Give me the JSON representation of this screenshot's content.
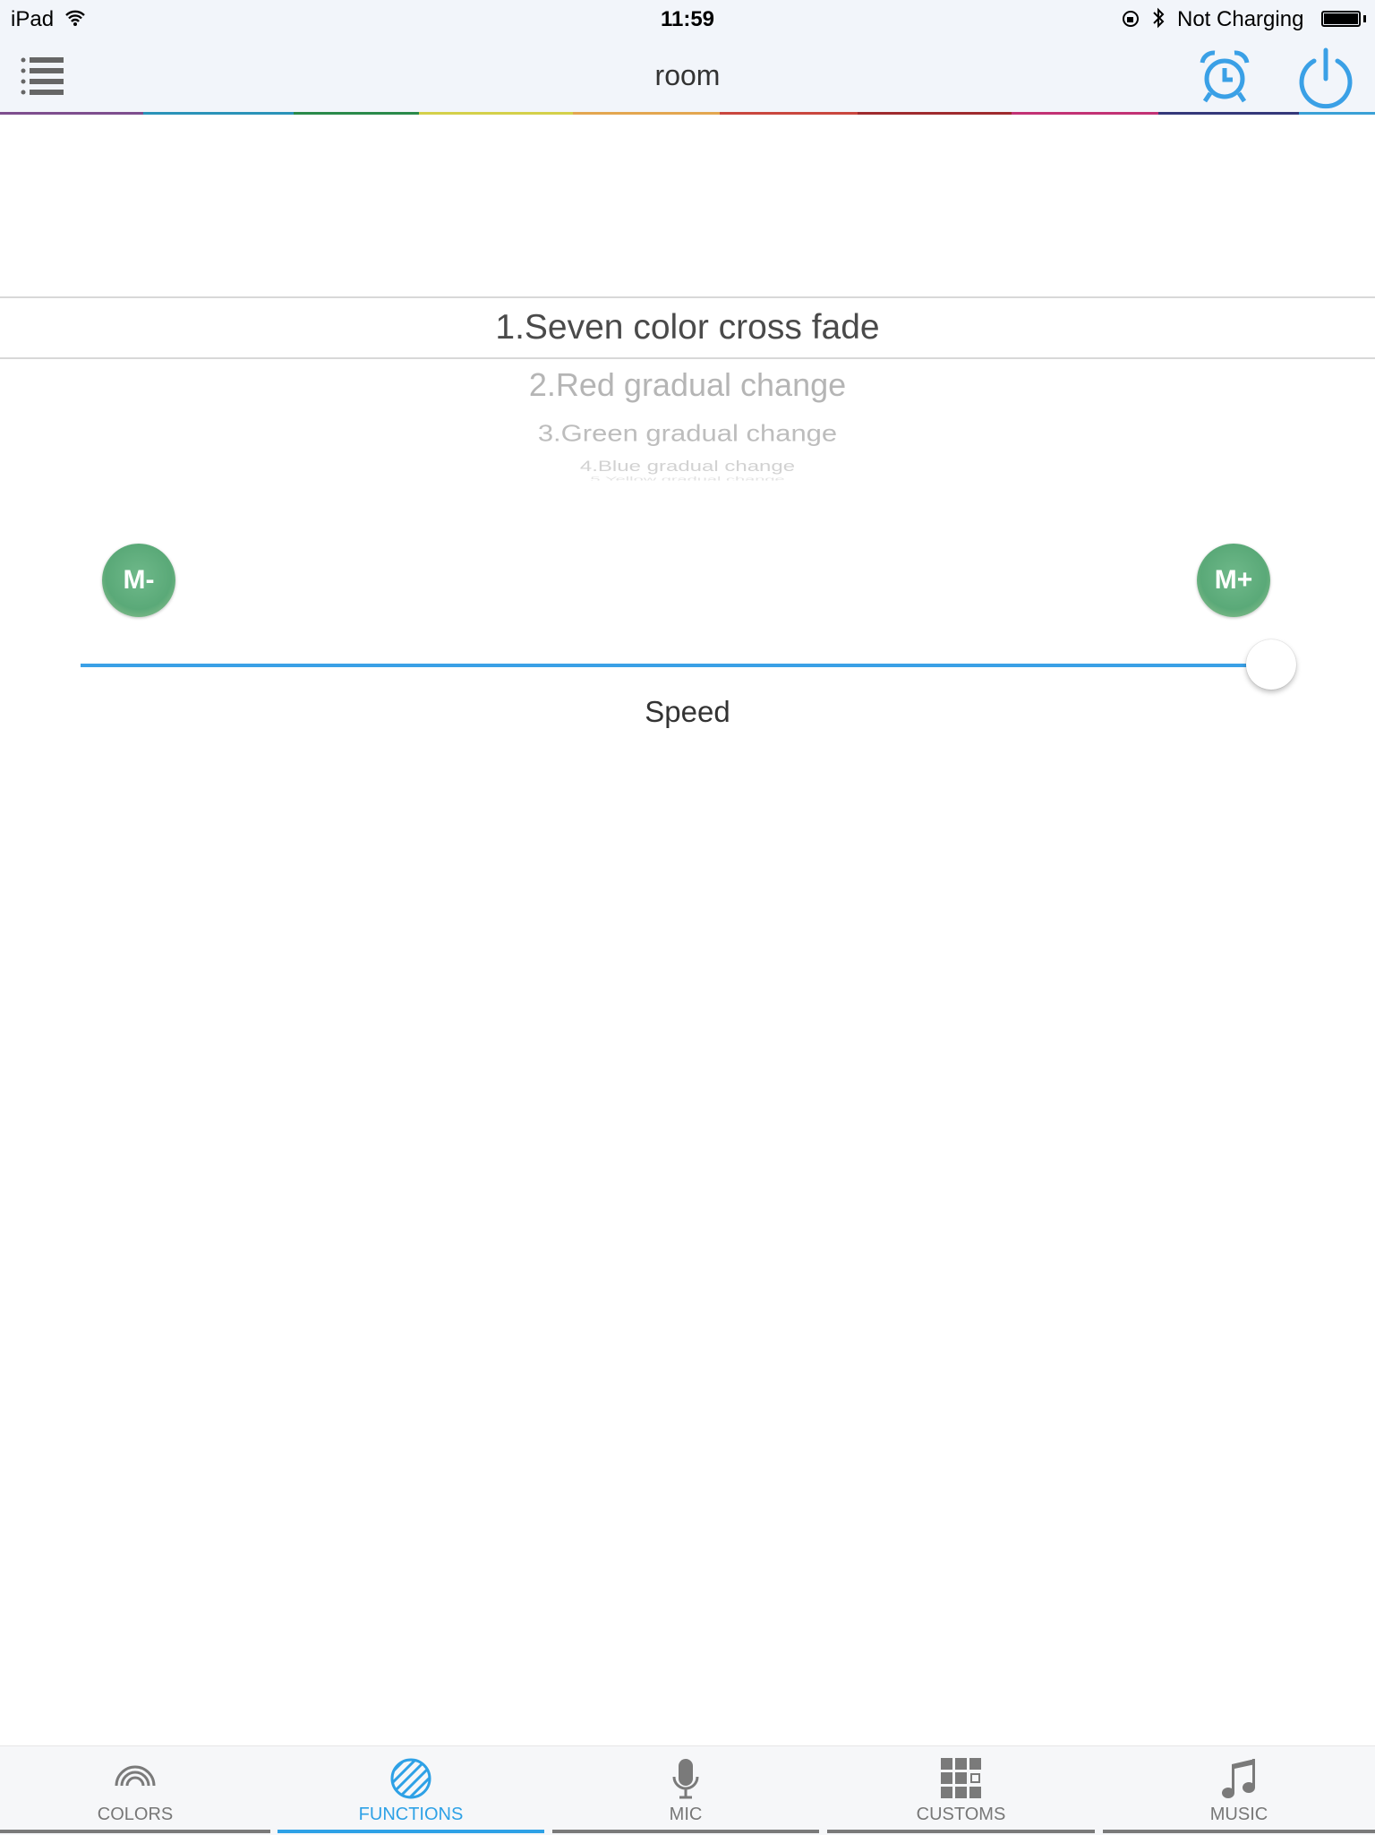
{
  "status_bar": {
    "device": "iPad",
    "time": "11:59",
    "battery_text": "Not Charging"
  },
  "nav": {
    "title": "room",
    "icons": [
      "list-icon",
      "alarm-clock-icon",
      "power-icon"
    ]
  },
  "colors": {
    "accent": "#2ea1e6",
    "button_green": "#5aa978",
    "rainbow": [
      "#7e4e8e",
      "#2a93b8",
      "#2a8a4a",
      "#d4d04a",
      "#e3a650",
      "#c9463e",
      "#9e2a2e",
      "#c23174",
      "#34387a",
      "#3aa0d6"
    ]
  },
  "picker": {
    "selected": "1.Seven color cross fade",
    "items": [
      "2.Red  gradual change",
      "3.Green gradual change",
      "4.Blue gradual change",
      "5.Yellow gradual change"
    ]
  },
  "controls": {
    "minus_label": "M-",
    "plus_label": "M+",
    "slider_label": "Speed",
    "speed_value_percent": 100
  },
  "tabs": [
    {
      "label": "COLORS",
      "icon": "rainbow-icon",
      "active": false
    },
    {
      "label": "FUNCTIONS",
      "icon": "striped-circle-icon",
      "active": true
    },
    {
      "label": "MIC",
      "icon": "microphone-icon",
      "active": false
    },
    {
      "label": "CUSTOMS",
      "icon": "grid-icon",
      "active": false
    },
    {
      "label": "MUSIC",
      "icon": "music-note-icon",
      "active": false
    }
  ]
}
